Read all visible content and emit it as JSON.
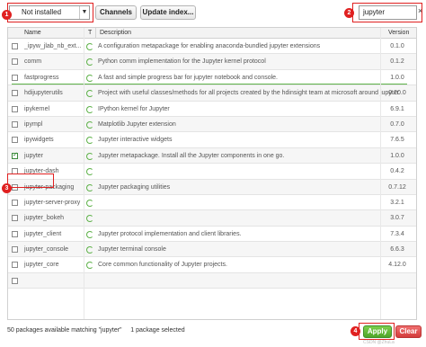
{
  "toolbar": {
    "filter_value": "Not installed",
    "channels_label": "Channels",
    "update_index_label": "Update index...",
    "search_value": "jupyter",
    "clear_search_icon": "×"
  },
  "annotations": [
    "1",
    "2",
    "3",
    "4"
  ],
  "table": {
    "headers": {
      "name": "Name",
      "type": "T",
      "description": "Description",
      "version": "Version"
    },
    "rows": [
      {
        "name": "_ipyw_jlab_nb_ext...",
        "description": "A configuration metapackage for enabling anaconda-bundled jupyter extensions",
        "version": "0.1.0",
        "checked": false
      },
      {
        "name": "comm",
        "description": "Python comm implementation for the Jupyter kernel protocol",
        "version": "0.1.2",
        "checked": false
      },
      {
        "name": "fastprogress",
        "description": "A fast and simple progress bar for jupyter notebook and console.",
        "version": "1.0.0",
        "checked": false
      },
      {
        "name": "hdijupyterutils",
        "description": "Project with useful classes/methods for all projects created by the hdinsight team at microsoft around jupyter",
        "version": "0.20.0",
        "checked": false
      },
      {
        "name": "ipykernel",
        "description": "IPython kernel for Jupyter",
        "version": "6.9.1",
        "checked": false
      },
      {
        "name": "ipympl",
        "description": "Matplotlib Jupyter extension",
        "version": "0.7.0",
        "checked": false
      },
      {
        "name": "ipywidgets",
        "description": "Jupyter interactive widgets",
        "version": "7.6.5",
        "checked": false
      },
      {
        "name": "jupyter",
        "description": "Jupyter metapackage. Install all the Jupyter components in one go.",
        "version": "1.0.0",
        "checked": true
      },
      {
        "name": "jupyter-dash",
        "description": "",
        "version": "0.4.2",
        "checked": false
      },
      {
        "name": "jupyter-packaging",
        "description": "Jupyter packaging utilities",
        "version": "0.7.12",
        "checked": false
      },
      {
        "name": "jupyter-server-proxy",
        "description": "",
        "version": "3.2.1",
        "checked": false
      },
      {
        "name": "jupyter_bokeh",
        "description": "",
        "version": "3.0.7",
        "checked": false
      },
      {
        "name": "jupyter_client",
        "description": "Jupyter protocol implementation and client libraries.",
        "version": "7.3.4",
        "checked": false
      },
      {
        "name": "jupyter_console",
        "description": "Jupyter terminal console",
        "version": "6.6.3",
        "checked": false
      },
      {
        "name": "jupyter_core",
        "description": "Core common functionality of Jupyter projects.",
        "version": "4.12.0",
        "checked": false
      },
      {
        "name": "",
        "description": "",
        "version": "",
        "checked": false
      }
    ]
  },
  "statusbar": {
    "matching_text": "50 packages available matching \"jupyter\"",
    "selected_text": "1 package selected"
  },
  "actions": {
    "apply_label": "Apply",
    "clear_label": "Clear"
  },
  "watermark": "CSDN @ZhuLa"
}
